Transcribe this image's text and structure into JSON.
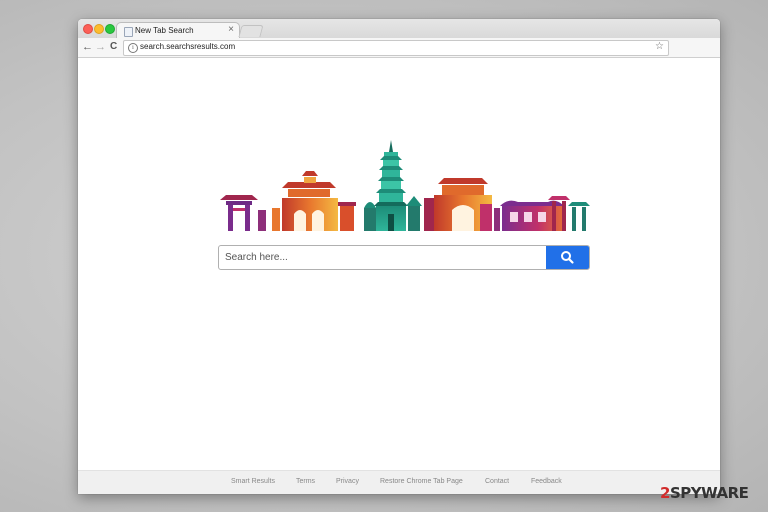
{
  "tab": {
    "title": "New Tab Search",
    "close": "×"
  },
  "nav": {
    "back": "←",
    "forward": "→",
    "reload": "C"
  },
  "address": {
    "url": "search.searchsresults.com",
    "info": "i",
    "star": "☆"
  },
  "search": {
    "placeholder": "Search here..."
  },
  "footer": {
    "links": [
      "Smart Results",
      "Terms",
      "Privacy",
      "Restore Chrome Tab Page",
      "Contact",
      "Feedback"
    ]
  },
  "watermark": {
    "num": "2",
    "spy": "SPYWAR",
    "end": "E"
  },
  "colors": {
    "accent": "#2170e8",
    "watermark_red": "#d12b2b"
  },
  "icons": {
    "search": "search-icon",
    "info": "info-icon",
    "bookmark": "star-icon"
  }
}
